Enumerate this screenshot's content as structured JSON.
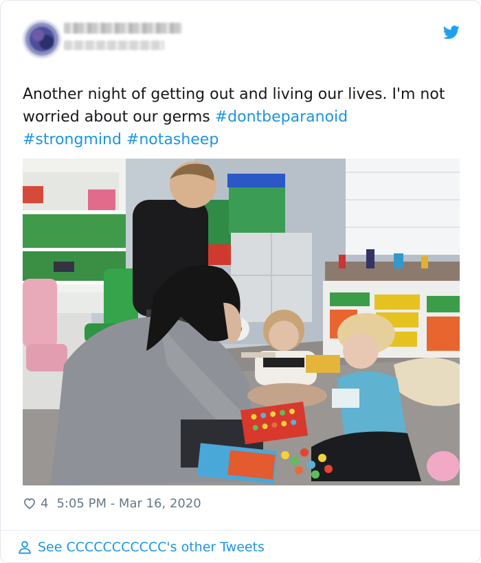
{
  "tweet": {
    "text_plain": "Another night of getting out and living our lives. I'm not worried about our germs ",
    "hashtags": [
      "#dontbeparanoid",
      "#strongmind",
      "#notasheep"
    ]
  },
  "meta": {
    "like_count": "4",
    "timestamp": "5:05 PM - Mar 16, 2020"
  },
  "footer": {
    "see_other_tweets": "See CCCCCCCCCCC's other Tweets"
  },
  "colors": {
    "link": "#1b95e0",
    "text": "#14171a",
    "muted": "#657786",
    "border": "#e1e8ed"
  },
  "icons": {
    "brand": "twitter-bird-icon",
    "like": "heart-icon",
    "profile": "person-icon"
  }
}
